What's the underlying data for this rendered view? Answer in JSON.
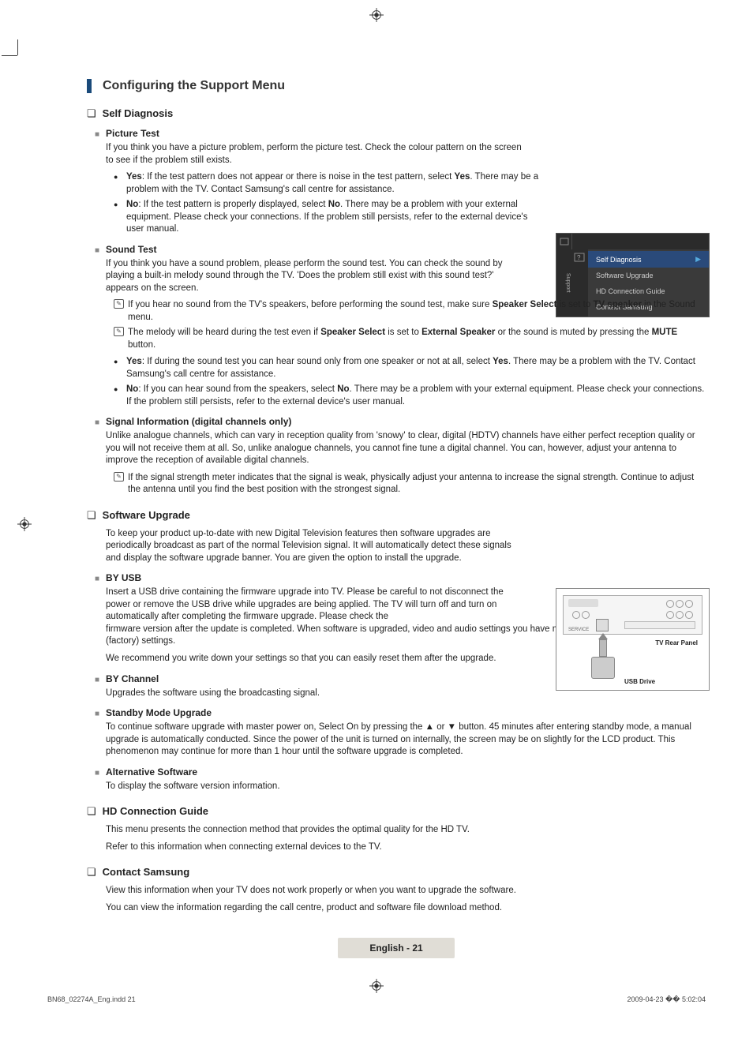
{
  "header": {
    "title": "Configuring the Support Menu"
  },
  "selfdiag": {
    "title": "Self Diagnosis",
    "picture": {
      "title": "Picture Test",
      "intro": "If you think you have a picture problem, perform the picture test. Check the colour pattern on the screen to see if the problem still exists.",
      "yes": "Yes: If the test pattern does not appear or there is noise in the test pattern, select Yes. There may be a problem with the TV. Contact Samsung's call centre for assistance.",
      "no": "No: If the test pattern is properly displayed, select No. There may be a problem with your external equipment. Please check your connections. If the problem still persists, refer to the external device's user manual."
    },
    "sound": {
      "title": "Sound Test",
      "intro": "If you think you have a sound problem, please perform the sound test. You can check the sound by playing a built-in melody sound through the TV. 'Does the problem still exist with this sound test?' appears on the screen.",
      "note1": "If you hear no sound from the TV's speakers, before performing the sound test, make sure Speaker Select is set to TV speaker in the Sound menu.",
      "note2": "The melody will be heard during the test even if Speaker Select is set to External Speaker or the sound is muted by pressing the MUTE button.",
      "yes": "Yes: If during the sound test you can hear sound only from one speaker or not at all, select Yes. There may be a problem with the TV. Contact Samsung's call centre for assistance.",
      "no": "No: If you can hear sound from the speakers, select No. There may be a problem with your external equipment. Please check your connections. If the problem still persists, refer to the external device's user manual."
    },
    "signal": {
      "title": "Signal Information (digital channels only)",
      "intro": "Unlike analogue channels, which can vary in reception quality from 'snowy' to clear, digital (HDTV) channels have either perfect reception quality or you will not receive them at all. So, unlike analogue channels, you cannot fine tune a digital channel. You can, however, adjust your antenna to improve the reception of available digital channels.",
      "note1": "If the signal strength meter indicates that the signal is weak, physically adjust your antenna to increase the signal strength. Continue to adjust the antenna until you find the best position with the strongest signal."
    }
  },
  "software": {
    "title": "Software Upgrade",
    "intro": "To keep your product up-to-date with new Digital Television features then software upgrades are periodically broadcast as part of the normal Television signal. It will automatically detect these signals and display the software upgrade banner. You are given the option to install the upgrade.",
    "byusb": {
      "title": "BY USB",
      "text": "Insert a USB drive containing the firmware upgrade into TV. Please be careful to not disconnect the power or remove the USB drive while upgrades are being applied. The TV will turn off and turn on automatically after completing the firmware upgrade. Please check the firmware version after the update is completed. When software is upgraded, video and audio settings you have made will return to their default (factory) settings.",
      "text2": "We recommend you write down your settings so that you can easily reset them after the upgrade."
    },
    "bychannel": {
      "title": "BY Channel",
      "text": "Upgrades the software using the broadcasting signal."
    },
    "standby": {
      "title": "Standby Mode Upgrade",
      "text": "To continue software upgrade with master power on, Select On by pressing the ▲ or ▼ button. 45 minutes after entering standby mode, a manual upgrade is automatically conducted. Since the power of the unit is turned on internally, the screen may be on slightly for the LCD product. This phenomenon may continue for more than 1 hour until the software upgrade is completed."
    },
    "alt": {
      "title": "Alternative Software",
      "text": "To display the software version information."
    }
  },
  "hdguide": {
    "title": "HD Connection Guide",
    "text1": "This menu presents the connection method that provides the optimal quality for the HD TV.",
    "text2": "Refer to this information when connecting external devices to the TV."
  },
  "contact": {
    "title": "Contact Samsung",
    "text1": "View this information when your TV does not work properly or when you want to upgrade the software.",
    "text2": "You can view the information regarding the call centre, product and software file download method."
  },
  "osd": {
    "side": "Support",
    "items": [
      "Self Diagnosis",
      "Software Upgrade",
      "HD Connection Guide",
      "Contact Samsung"
    ]
  },
  "diagram": {
    "rear": "TV Rear Panel",
    "usb": "USB Drive"
  },
  "footer": {
    "label": "English - 21",
    "doc": "BN68_02274A_Eng.indd   21",
    "date": "2009-04-23   �� 5:02:04"
  }
}
